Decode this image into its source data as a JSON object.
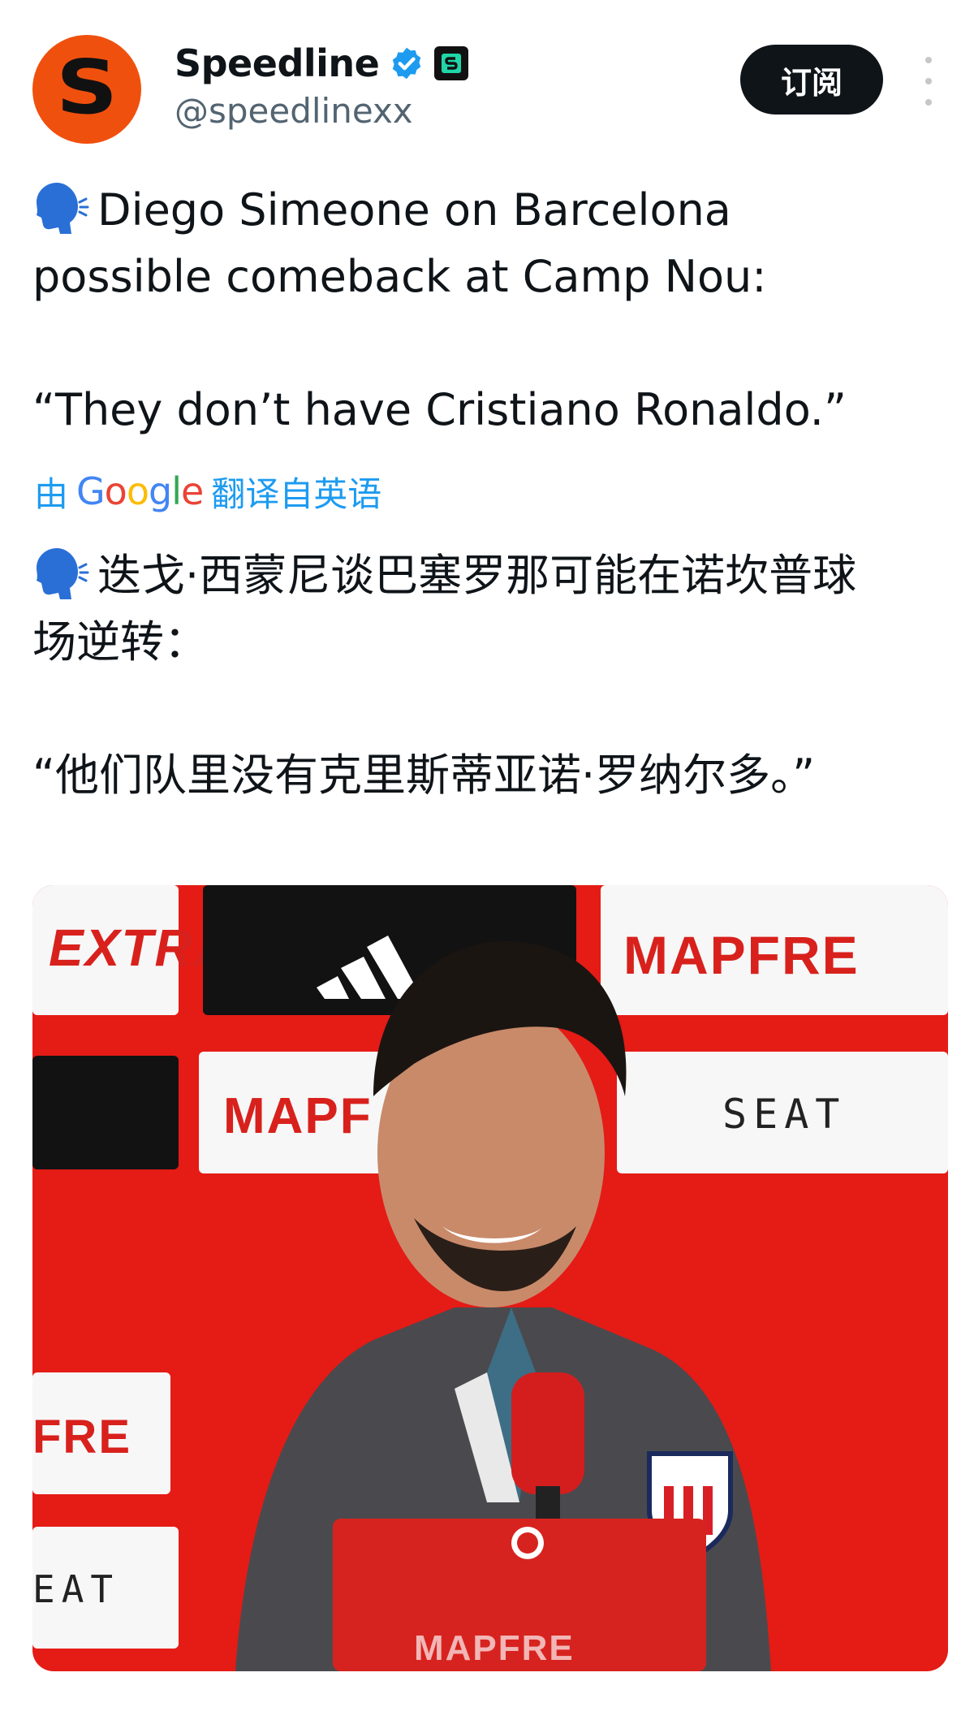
{
  "author": {
    "display_name": "Speedline",
    "handle": "@speedlinexx",
    "avatar_letter": "S",
    "avatar_color": "#f0500e"
  },
  "actions": {
    "subscribe_label": "订阅"
  },
  "tweet": {
    "lines": [
      "Diego Simeone on Barcelona",
      "possible comeback at Camp Nou:",
      "",
      "“They don’t have Cristiano Ronaldo.”"
    ]
  },
  "translation": {
    "prefix": "由",
    "provider": "Google",
    "suffix": "翻译自英语",
    "lines": [
      "迭戈·西蒙尼谈巴塞罗那可能在诺坎普球",
      "场逆转：",
      "",
      "“他们队里没有克里斯蒂亚诺·罗纳尔多。”"
    ]
  },
  "media": {
    "sponsor_boards": {
      "extra": "EXTRA",
      "mapfre": "MAPFRE",
      "mapf_partial": "MAPF",
      "fre_partial": "FRE",
      "seat": "SEAT",
      "eat_partial": "EAT",
      "bottom": "MAPFRE"
    },
    "background_color": "#e51b16"
  },
  "icons": [
    "verified-badge-icon",
    "affiliate-badge-icon",
    "more-icon",
    "speaking-head-icon",
    "google-logo"
  ]
}
